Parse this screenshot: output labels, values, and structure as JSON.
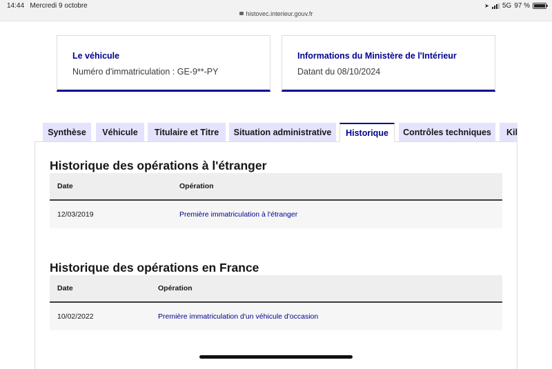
{
  "status_bar": {
    "time": "14:44",
    "date": "Mercredi 9 octobre",
    "url": "histovec.interieur.gouv.fr",
    "network": "5G",
    "battery": "97 %",
    "battery_level": 0.97
  },
  "cards": [
    {
      "title": "Le véhicule",
      "text": "Numéro d'immatriculation : GE-9**-PY"
    },
    {
      "title": "Informations du Ministère de l'Intérieur",
      "text": "Datant du 08/10/2024"
    }
  ],
  "tabs": [
    {
      "label": "Synthèse"
    },
    {
      "label": "Véhicule"
    },
    {
      "label": "Titulaire et Titre"
    },
    {
      "label": "Situation administrative"
    },
    {
      "label": "Historique"
    },
    {
      "label": "Contrôles techniques"
    },
    {
      "label": "Kilométrage"
    }
  ],
  "active_tab": "Historique",
  "foreign_history": {
    "title": "Historique des opérations à l'étranger",
    "headers": {
      "date": "Date",
      "operation": "Opération"
    },
    "rows": [
      {
        "date": "12/03/2019",
        "operation": "Première immatriculation à l'étranger"
      }
    ]
  },
  "france_history": {
    "title": "Historique des opérations en France",
    "headers": {
      "date": "Date",
      "operation": "Opération"
    },
    "rows": [
      {
        "date": "10/02/2022",
        "operation": "Première immatriculation d'un véhicule d'occasion"
      }
    ]
  },
  "colors": {
    "accent": "#000091",
    "tab_bg": "#e3e3fd",
    "table_head": "#eeeeee"
  }
}
